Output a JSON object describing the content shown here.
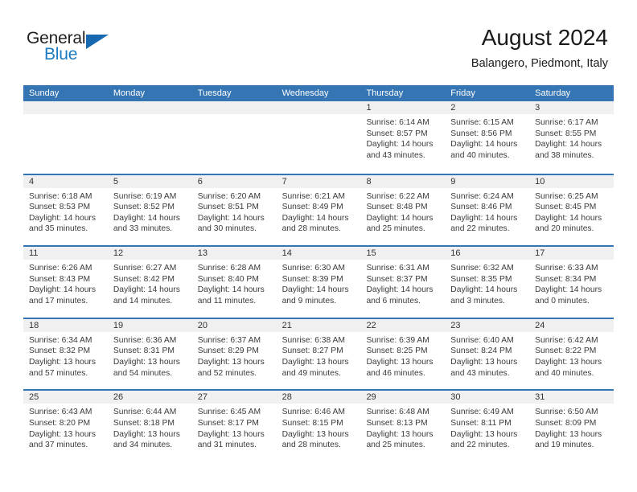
{
  "brand": {
    "name_part1": "General",
    "name_part2": "Blue",
    "logo_icon": "triangle-logo-icon"
  },
  "header": {
    "title": "August 2024",
    "subtitle": "Balangero, Piedmont, Italy"
  },
  "colors": {
    "header_blue": "#3575b4",
    "brand_blue": "#1c7bc1",
    "daynum_strip": "#f0f0f0",
    "text": "#3a3a3a"
  },
  "calendar": {
    "weekday_headers": [
      "Sunday",
      "Monday",
      "Tuesday",
      "Wednesday",
      "Thursday",
      "Friday",
      "Saturday"
    ],
    "weeks": [
      [
        {
          "day": "",
          "lines": []
        },
        {
          "day": "",
          "lines": []
        },
        {
          "day": "",
          "lines": []
        },
        {
          "day": "",
          "lines": []
        },
        {
          "day": "1",
          "lines": [
            "Sunrise: 6:14 AM",
            "Sunset: 8:57 PM",
            "Daylight: 14 hours",
            "and 43 minutes."
          ]
        },
        {
          "day": "2",
          "lines": [
            "Sunrise: 6:15 AM",
            "Sunset: 8:56 PM",
            "Daylight: 14 hours",
            "and 40 minutes."
          ]
        },
        {
          "day": "3",
          "lines": [
            "Sunrise: 6:17 AM",
            "Sunset: 8:55 PM",
            "Daylight: 14 hours",
            "and 38 minutes."
          ]
        }
      ],
      [
        {
          "day": "4",
          "lines": [
            "Sunrise: 6:18 AM",
            "Sunset: 8:53 PM",
            "Daylight: 14 hours",
            "and 35 minutes."
          ]
        },
        {
          "day": "5",
          "lines": [
            "Sunrise: 6:19 AM",
            "Sunset: 8:52 PM",
            "Daylight: 14 hours",
            "and 33 minutes."
          ]
        },
        {
          "day": "6",
          "lines": [
            "Sunrise: 6:20 AM",
            "Sunset: 8:51 PM",
            "Daylight: 14 hours",
            "and 30 minutes."
          ]
        },
        {
          "day": "7",
          "lines": [
            "Sunrise: 6:21 AM",
            "Sunset: 8:49 PM",
            "Daylight: 14 hours",
            "and 28 minutes."
          ]
        },
        {
          "day": "8",
          "lines": [
            "Sunrise: 6:22 AM",
            "Sunset: 8:48 PM",
            "Daylight: 14 hours",
            "and 25 minutes."
          ]
        },
        {
          "day": "9",
          "lines": [
            "Sunrise: 6:24 AM",
            "Sunset: 8:46 PM",
            "Daylight: 14 hours",
            "and 22 minutes."
          ]
        },
        {
          "day": "10",
          "lines": [
            "Sunrise: 6:25 AM",
            "Sunset: 8:45 PM",
            "Daylight: 14 hours",
            "and 20 minutes."
          ]
        }
      ],
      [
        {
          "day": "11",
          "lines": [
            "Sunrise: 6:26 AM",
            "Sunset: 8:43 PM",
            "Daylight: 14 hours",
            "and 17 minutes."
          ]
        },
        {
          "day": "12",
          "lines": [
            "Sunrise: 6:27 AM",
            "Sunset: 8:42 PM",
            "Daylight: 14 hours",
            "and 14 minutes."
          ]
        },
        {
          "day": "13",
          "lines": [
            "Sunrise: 6:28 AM",
            "Sunset: 8:40 PM",
            "Daylight: 14 hours",
            "and 11 minutes."
          ]
        },
        {
          "day": "14",
          "lines": [
            "Sunrise: 6:30 AM",
            "Sunset: 8:39 PM",
            "Daylight: 14 hours",
            "and 9 minutes."
          ]
        },
        {
          "day": "15",
          "lines": [
            "Sunrise: 6:31 AM",
            "Sunset: 8:37 PM",
            "Daylight: 14 hours",
            "and 6 minutes."
          ]
        },
        {
          "day": "16",
          "lines": [
            "Sunrise: 6:32 AM",
            "Sunset: 8:35 PM",
            "Daylight: 14 hours",
            "and 3 minutes."
          ]
        },
        {
          "day": "17",
          "lines": [
            "Sunrise: 6:33 AM",
            "Sunset: 8:34 PM",
            "Daylight: 14 hours",
            "and 0 minutes."
          ]
        }
      ],
      [
        {
          "day": "18",
          "lines": [
            "Sunrise: 6:34 AM",
            "Sunset: 8:32 PM",
            "Daylight: 13 hours",
            "and 57 minutes."
          ]
        },
        {
          "day": "19",
          "lines": [
            "Sunrise: 6:36 AM",
            "Sunset: 8:31 PM",
            "Daylight: 13 hours",
            "and 54 minutes."
          ]
        },
        {
          "day": "20",
          "lines": [
            "Sunrise: 6:37 AM",
            "Sunset: 8:29 PM",
            "Daylight: 13 hours",
            "and 52 minutes."
          ]
        },
        {
          "day": "21",
          "lines": [
            "Sunrise: 6:38 AM",
            "Sunset: 8:27 PM",
            "Daylight: 13 hours",
            "and 49 minutes."
          ]
        },
        {
          "day": "22",
          "lines": [
            "Sunrise: 6:39 AM",
            "Sunset: 8:25 PM",
            "Daylight: 13 hours",
            "and 46 minutes."
          ]
        },
        {
          "day": "23",
          "lines": [
            "Sunrise: 6:40 AM",
            "Sunset: 8:24 PM",
            "Daylight: 13 hours",
            "and 43 minutes."
          ]
        },
        {
          "day": "24",
          "lines": [
            "Sunrise: 6:42 AM",
            "Sunset: 8:22 PM",
            "Daylight: 13 hours",
            "and 40 minutes."
          ]
        }
      ],
      [
        {
          "day": "25",
          "lines": [
            "Sunrise: 6:43 AM",
            "Sunset: 8:20 PM",
            "Daylight: 13 hours",
            "and 37 minutes."
          ]
        },
        {
          "day": "26",
          "lines": [
            "Sunrise: 6:44 AM",
            "Sunset: 8:18 PM",
            "Daylight: 13 hours",
            "and 34 minutes."
          ]
        },
        {
          "day": "27",
          "lines": [
            "Sunrise: 6:45 AM",
            "Sunset: 8:17 PM",
            "Daylight: 13 hours",
            "and 31 minutes."
          ]
        },
        {
          "day": "28",
          "lines": [
            "Sunrise: 6:46 AM",
            "Sunset: 8:15 PM",
            "Daylight: 13 hours",
            "and 28 minutes."
          ]
        },
        {
          "day": "29",
          "lines": [
            "Sunrise: 6:48 AM",
            "Sunset: 8:13 PM",
            "Daylight: 13 hours",
            "and 25 minutes."
          ]
        },
        {
          "day": "30",
          "lines": [
            "Sunrise: 6:49 AM",
            "Sunset: 8:11 PM",
            "Daylight: 13 hours",
            "and 22 minutes."
          ]
        },
        {
          "day": "31",
          "lines": [
            "Sunrise: 6:50 AM",
            "Sunset: 8:09 PM",
            "Daylight: 13 hours",
            "and 19 minutes."
          ]
        }
      ]
    ]
  }
}
